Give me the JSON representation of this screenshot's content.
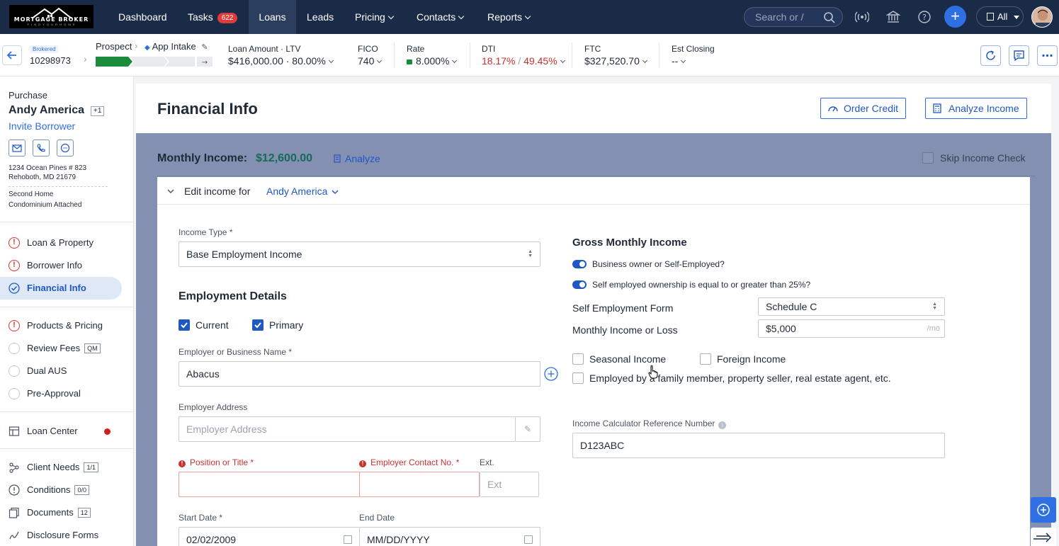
{
  "brand": {
    "logo_text": "MORTGAGE BROKER",
    "logo_sub": "F I N D  Y O U R  H O M E"
  },
  "nav": {
    "dashboard": "Dashboard",
    "tasks": "Tasks",
    "tasks_count": "622",
    "loans": "Loans",
    "leads": "Leads",
    "pricing": "Pricing",
    "contacts": "Contacts",
    "reports": "Reports",
    "search_placeholder": "Search or /",
    "all_label": "All"
  },
  "loan_header": {
    "brokered": "Brokered",
    "loan_number": "10298973",
    "stage_from": "Prospect",
    "stage_to": "App Intake",
    "loan_amount_label": "Loan Amount · LTV",
    "loan_amount_value": "$416,000.00 · 80.00%",
    "fico_label": "FICO",
    "fico_value": "740",
    "rate_label": "Rate",
    "rate_value": "8.000%",
    "dti_label": "DTI",
    "dti_front": "18.17%",
    "dti_sep": "/",
    "dti_back": "49.45%",
    "ftc_label": "FTC",
    "ftc_value": "$327,520.70",
    "est_closing_label": "Est Closing",
    "est_closing_value": "--"
  },
  "sidebar": {
    "purpose": "Purchase",
    "borrower": "Andy America",
    "extra_borrowers": "+1",
    "invite": "Invite Borrower",
    "address_line1": "1234 Ocean Pines # 823",
    "address_line2": "Rehoboth, MD 21679",
    "occupancy": "Second Home",
    "property_type": "Condominium Attached",
    "items": [
      {
        "label": "Loan & Property",
        "status": "error"
      },
      {
        "label": "Borrower Info",
        "status": "error"
      },
      {
        "label": "Financial Info",
        "status": "done"
      },
      {
        "label": "Products & Pricing",
        "status": "error"
      },
      {
        "label": "Review Fees",
        "status": "pending",
        "tag": "QM"
      },
      {
        "label": "Dual AUS",
        "status": "pending"
      },
      {
        "label": "Pre-Approval",
        "status": "pending"
      },
      {
        "label": "Loan Center",
        "status": "alert"
      },
      {
        "label": "Client Needs",
        "tag": "1/1"
      },
      {
        "label": "Conditions",
        "tag": "0/0"
      },
      {
        "label": "Documents",
        "tag": "12"
      },
      {
        "label": "Disclosure Forms"
      }
    ]
  },
  "page": {
    "title": "Financial Info",
    "order_credit": "Order Credit",
    "analyze_income": "Analyze Income",
    "monthly_income_label": "Monthly Income:",
    "monthly_income_value": "$12,600.00",
    "analyze": "Analyze",
    "skip_income_check": "Skip Income Check",
    "edit_income_for": "Edit income for",
    "edit_income_borrower": "Andy America"
  },
  "form": {
    "income_type_label": "Income Type *",
    "income_type_value": "Base Employment Income",
    "employment_details": "Employment Details",
    "current": "Current",
    "primary": "Primary",
    "employer_label": "Employer or Business Name *",
    "employer_value": "Abacus",
    "employer_address_label": "Employer Address",
    "employer_address_placeholder": "Employer Address",
    "position_label": "Position or Title *",
    "contact_label": "Employer Contact No. *",
    "ext_label": "Ext.",
    "ext_placeholder": "Ext",
    "start_date_label": "Start Date *",
    "start_date_value": "02/02/2009",
    "end_date_label": "End Date",
    "end_date_placeholder": "MM/DD/YYYY",
    "gross_monthly_income": "Gross Monthly Income",
    "toggle_business_owner": "Business owner or Self-Employed?",
    "toggle_ownership": "Self employed ownership is equal to or greater than 25%?",
    "self_employment_form_label": "Self Employment Form",
    "self_employment_form_value": "Schedule C",
    "monthly_income_loss_label": "Monthly Income or Loss",
    "monthly_income_loss_value": "$5,000",
    "monthly_suffix": "/mo",
    "seasonal_income": "Seasonal Income",
    "foreign_income": "Foreign Income",
    "employed_by_family": "Employed by a family member, property seller, real estate agent, etc.",
    "calc_ref_label": "Income Calculator Reference Number",
    "calc_ref_value": "D123ABC"
  },
  "colors": {
    "nav_bg": "#1a2b48",
    "accent": "#1f57c3",
    "band": "#8390b1",
    "income_green": "#176a57",
    "error": "#c8322f"
  }
}
